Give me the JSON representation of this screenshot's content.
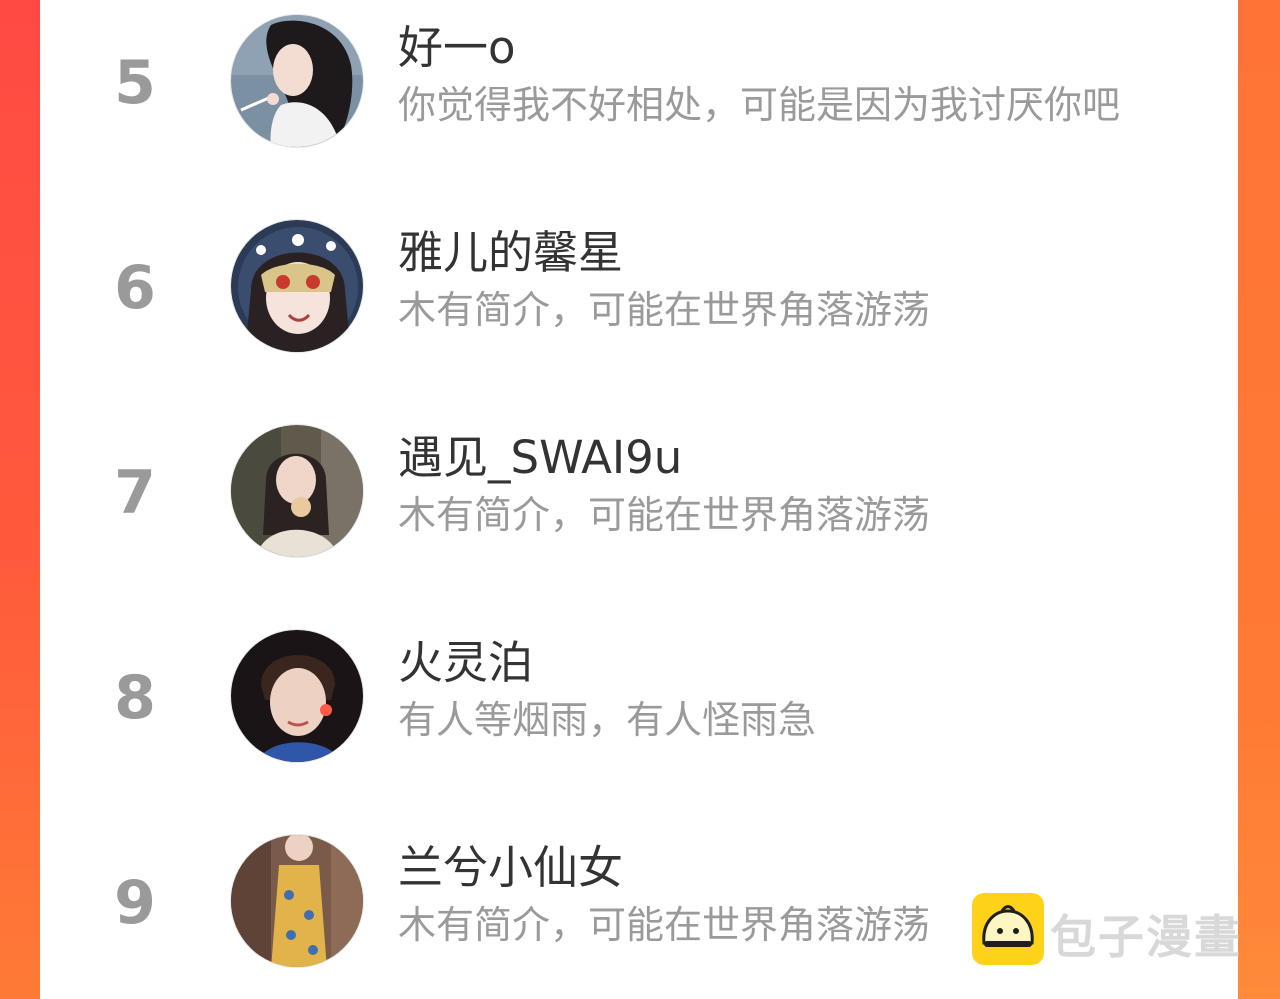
{
  "watermark": {
    "text": "包子漫畫",
    "icon": "bun-face-icon",
    "color": "#ffd21a"
  },
  "colors": {
    "accent": "#ff5040",
    "rank": "#9a9a9a",
    "name": "#333333",
    "bio": "#9a9a9a"
  },
  "ranking": [
    {
      "rank": "5",
      "name": "好一o",
      "bio": "你觉得我不好相处，可能是因为我讨厌你吧",
      "avatar": "avatar-girl-illustration"
    },
    {
      "rank": "6",
      "name": "雅儿的馨星",
      "bio": "木有简介，可能在世界角落游荡",
      "avatar": "avatar-masked-girl-illustration"
    },
    {
      "rank": "7",
      "name": "遇见_SWAI9u",
      "bio": "木有简介，可能在世界角落游荡",
      "avatar": "avatar-girl-photo"
    },
    {
      "rank": "8",
      "name": "火灵泊",
      "bio": "有人等烟雨，有人怪雨急",
      "avatar": "avatar-boy-photo"
    },
    {
      "rank": "9",
      "name": "兰兮小仙女",
      "bio": "木有简介，可能在世界角落游荡",
      "avatar": "avatar-dress-photo"
    }
  ]
}
